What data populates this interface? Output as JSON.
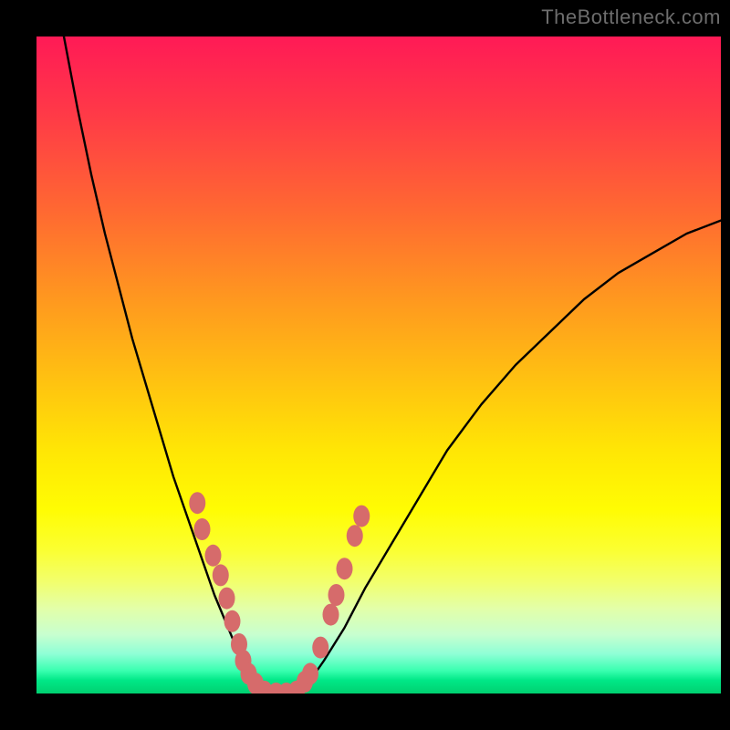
{
  "watermark": "TheBottleneck.com",
  "chart_data": {
    "type": "line",
    "title": "",
    "xlabel": "",
    "ylabel": "",
    "xlim": [
      0,
      100
    ],
    "ylim": [
      0,
      100
    ],
    "gradient_stops": [
      {
        "pct": 0,
        "color": "#ff1a56"
      },
      {
        "pct": 12,
        "color": "#ff3a47"
      },
      {
        "pct": 27,
        "color": "#ff6a31"
      },
      {
        "pct": 40,
        "color": "#ff981f"
      },
      {
        "pct": 53,
        "color": "#ffc410"
      },
      {
        "pct": 63,
        "color": "#ffe605"
      },
      {
        "pct": 72,
        "color": "#fffc03"
      },
      {
        "pct": 78,
        "color": "#fbff30"
      },
      {
        "pct": 83,
        "color": "#f2ff6d"
      },
      {
        "pct": 87,
        "color": "#e3ffa8"
      },
      {
        "pct": 91,
        "color": "#c8ffcf"
      },
      {
        "pct": 94,
        "color": "#8effd6"
      },
      {
        "pct": 96.5,
        "color": "#3affb0"
      },
      {
        "pct": 98,
        "color": "#00e887"
      },
      {
        "pct": 100,
        "color": "#00d070"
      }
    ],
    "series": [
      {
        "name": "left_curve",
        "x": [
          4,
          6,
          8,
          10,
          12,
          14,
          16,
          18,
          20,
          22,
          24,
          26,
          28,
          30,
          31,
          32,
          33,
          34
        ],
        "y": [
          100,
          89,
          79,
          70,
          62,
          54,
          47,
          40,
          33,
          27,
          21,
          15,
          10,
          5,
          3,
          1.5,
          0.6,
          0
        ]
      },
      {
        "name": "right_curve",
        "x": [
          38,
          40,
          42,
          45,
          48,
          52,
          56,
          60,
          65,
          70,
          75,
          80,
          85,
          90,
          95,
          100
        ],
        "y": [
          0,
          2,
          5,
          10,
          16,
          23,
          30,
          37,
          44,
          50,
          55,
          60,
          64,
          67,
          70,
          72
        ]
      },
      {
        "name": "floor",
        "x": [
          34,
          36,
          38
        ],
        "y": [
          0,
          0,
          0
        ]
      }
    ],
    "scatter": [
      {
        "x": 23.5,
        "y": 29
      },
      {
        "x": 24.2,
        "y": 25
      },
      {
        "x": 25.8,
        "y": 21
      },
      {
        "x": 26.9,
        "y": 18
      },
      {
        "x": 27.8,
        "y": 14.5
      },
      {
        "x": 28.6,
        "y": 11
      },
      {
        "x": 29.6,
        "y": 7.5
      },
      {
        "x": 30.2,
        "y": 5
      },
      {
        "x": 31,
        "y": 3
      },
      {
        "x": 32,
        "y": 1.5
      },
      {
        "x": 33.3,
        "y": 0.3
      },
      {
        "x": 35,
        "y": 0
      },
      {
        "x": 36.5,
        "y": 0
      },
      {
        "x": 38,
        "y": 0.3
      },
      {
        "x": 39.2,
        "y": 1.8
      },
      {
        "x": 40,
        "y": 3
      },
      {
        "x": 41.5,
        "y": 7
      },
      {
        "x": 43,
        "y": 12
      },
      {
        "x": 43.8,
        "y": 15
      },
      {
        "x": 45,
        "y": 19
      },
      {
        "x": 46.5,
        "y": 24
      },
      {
        "x": 47.5,
        "y": 27
      }
    ],
    "scatter_style": {
      "fill": "#d66b6b",
      "rx": 9,
      "ry": 12
    },
    "curve_style": {
      "stroke": "#000000",
      "width": 2.4
    }
  }
}
